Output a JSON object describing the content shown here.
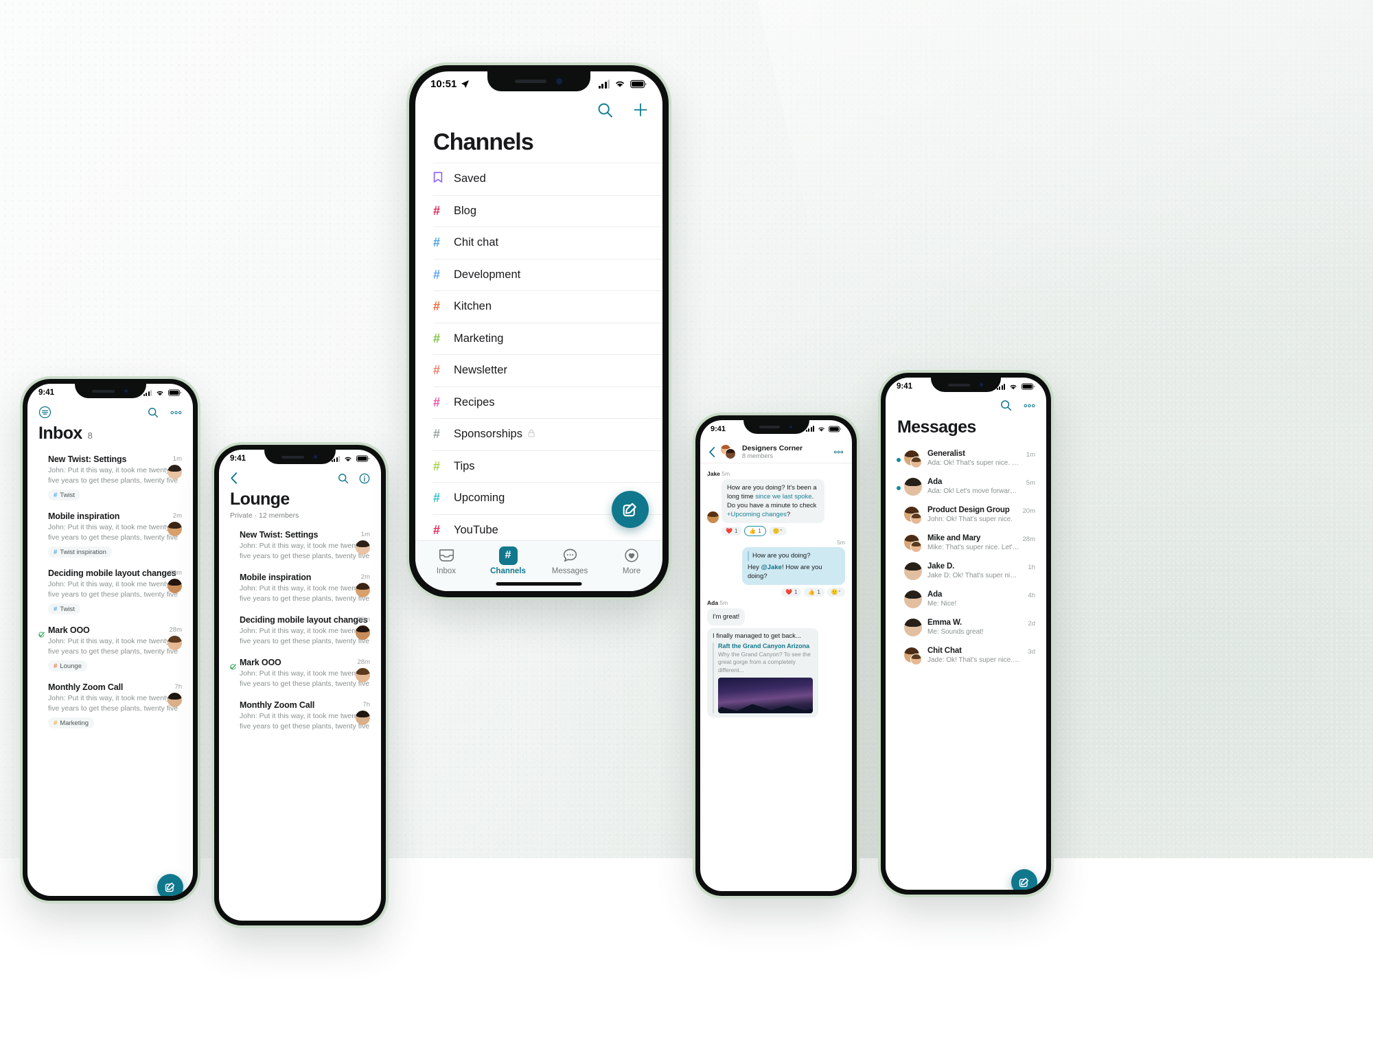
{
  "channels_phone": {
    "status": {
      "time": "10:51",
      "location_icon": "location-arrow-icon"
    },
    "nav": {
      "search": "search-icon",
      "add": "plus-icon"
    },
    "title": "Channels",
    "rows": [
      {
        "label": "Saved",
        "glyph": "bookmark-icon",
        "color": "#8b5cf6",
        "locked": false
      },
      {
        "label": "Blog",
        "glyph": "#",
        "color": "#e0295b",
        "locked": false
      },
      {
        "label": "Chit chat",
        "glyph": "#",
        "color": "#4aa3e8",
        "locked": false
      },
      {
        "label": "Development",
        "glyph": "#",
        "color": "#5fa8ef",
        "locked": false
      },
      {
        "label": "Kitchen",
        "glyph": "#",
        "color": "#ef6a3c",
        "locked": false
      },
      {
        "label": "Marketing",
        "glyph": "#",
        "color": "#7fc542",
        "locked": false
      },
      {
        "label": "Newsletter",
        "glyph": "#",
        "color": "#f07f6a",
        "locked": false
      },
      {
        "label": "Recipes",
        "glyph": "#",
        "color": "#e857a8",
        "locked": false
      },
      {
        "label": "Sponsorships",
        "glyph": "#",
        "color": "#9aa3a2",
        "locked": true
      },
      {
        "label": "Tips",
        "glyph": "#",
        "color": "#a6d44a",
        "locked": false
      },
      {
        "label": "Upcoming",
        "glyph": "#",
        "color": "#35c5cf",
        "locked": false
      },
      {
        "label": "YouTube",
        "glyph": "#",
        "color": "#e0295b",
        "locked": false
      }
    ],
    "compose": "compose-icon",
    "tabs": [
      {
        "label": "Inbox",
        "icon": "inbox-icon",
        "active": false
      },
      {
        "label": "Channels",
        "icon": "hash-icon",
        "active": true
      },
      {
        "label": "Messages",
        "icon": "chat-bubble-icon",
        "active": false
      },
      {
        "label": "More",
        "icon": "heart-circle-icon",
        "active": false
      }
    ]
  },
  "inbox_phone": {
    "status": {
      "time": "9:41"
    },
    "nav": {
      "filter": "filter-icon",
      "search": "search-icon"
    },
    "title": "Inbox",
    "count": "8",
    "items": [
      {
        "title": "New Twist: Settings",
        "preview": "John: Put it this way, it took me twenty five years to get these plants, twenty five years of",
        "channel": "Twist",
        "channel_color": "#4aa3e8",
        "time": "1m",
        "marker": "unread-dot",
        "avatar": "face-a"
      },
      {
        "title": "Mobile inspiration",
        "preview": "John: Put it this way, it took me twenty five years to get these plants, twenty five years of",
        "channel": "Twist inspiration",
        "channel_color": "#4aa3e8",
        "time": "2m",
        "marker": "purple-square",
        "avatar": "face-b"
      },
      {
        "title": "Deciding mobile layout changes",
        "preview": "John: Put it this way, it took me twenty five years to get these plants, twenty five years of",
        "channel": "Twist",
        "channel_color": "#4aa3e8",
        "time": "20m",
        "marker": "none",
        "avatar": "face-c"
      },
      {
        "title": "Mark OOO",
        "preview": "John: Put it this way, it took me twenty five years to get these plants, twenty five years of",
        "channel": "Lounge",
        "channel_color": "#ef6a3c",
        "time": "28m",
        "marker": "green-check",
        "avatar": "face-d"
      },
      {
        "title": "Monthly Zoom Call",
        "preview": "John: Put it this way, it took me twenty five years to get these plants, twenty five years of",
        "channel": "Marketing",
        "channel_color": "#f0a93c",
        "time": "7h",
        "marker": "unread-dot",
        "avatar": "face-e"
      }
    ],
    "compose": "compose-icon"
  },
  "lounge_phone": {
    "status": {
      "time": "9:41"
    },
    "nav": {
      "back": "chevron-left-icon",
      "search": "search-icon",
      "info": "info-circle-icon"
    },
    "title": "Lounge",
    "subtitle": "Private · 12 members",
    "items": [
      {
        "title": "New Twist: Settings",
        "preview": "John: Put it this way, it took me twenty five years to get these plants, twenty five years of",
        "time": "1m",
        "marker": "unread-dot",
        "avatar": "face-a"
      },
      {
        "title": "Mobile inspiration",
        "preview": "John: Put it this way, it took me twenty five years to get these plants, twenty five years of",
        "time": "2m",
        "marker": "purple-square",
        "avatar": "face-b"
      },
      {
        "title": "Deciding mobile layout changes",
        "preview": "John: Put it this way, it took me twenty five years to get these plants, twenty five years of",
        "time": "20m",
        "marker": "none",
        "avatar": "face-c"
      },
      {
        "title": "Mark OOO",
        "preview": "John: Put it this way, it took me twenty five years to get these plants, twenty five years of",
        "time": "28m",
        "marker": "green-check",
        "avatar": "face-d"
      },
      {
        "title": "Monthly Zoom Call",
        "preview": "John: Put it this way, it took me twenty five years to get these plants, twenty five years of",
        "time": "7h",
        "marker": "unread-dot",
        "avatar": "face-e"
      }
    ]
  },
  "chat_phone": {
    "status": {
      "time": "9:41"
    },
    "header": {
      "back": "chevron-left-icon",
      "name": "Designers Corner",
      "members": "8 members",
      "more": "more-horizontal-icon"
    },
    "messages": [
      {
        "author": "Jake",
        "time": "5m",
        "side": "left",
        "text_parts": [
          {
            "t": "How are you doing? It's been a long time ",
            "style": "plain"
          },
          {
            "t": "since we last spoke",
            "style": "link"
          },
          {
            "t": ". Do you have a minute to check ",
            "style": "plain"
          },
          {
            "t": "+Upcoming changes",
            "style": "link"
          },
          {
            "t": "?",
            "style": "plain"
          }
        ],
        "reactions": [
          {
            "emoji": "❤️",
            "count": "1",
            "selected": false
          },
          {
            "emoji": "👍",
            "count": "1",
            "selected": true
          }
        ],
        "add_reaction": "add-reaction-icon"
      },
      {
        "time": "5m",
        "side": "right",
        "quote": "How are you doing?",
        "text_parts": [
          {
            "t": "Hey ",
            "style": "plain"
          },
          {
            "t": "@Jake",
            "style": "mention"
          },
          {
            "t": "! How are you doing?",
            "style": "plain"
          }
        ],
        "reactions": [
          {
            "emoji": "❤️",
            "count": "1",
            "selected": false
          },
          {
            "emoji": "👍",
            "count": "1",
            "selected": false
          }
        ],
        "add_reaction": "add-reaction-icon"
      },
      {
        "author": "Ada",
        "time": "5m",
        "side": "left",
        "text_parts": [
          {
            "t": "I'm great!",
            "style": "plain"
          }
        ]
      }
    ],
    "link_card": {
      "caption": "I finally managed to get back...",
      "title": "Raft the Grand Canyon Arizona",
      "description": "Why the Grand Canyon? To see the great gorge from a completely different...",
      "image": "night-sky-mountains-photo"
    }
  },
  "messages_phone": {
    "status": {
      "time": "9:41"
    },
    "nav": {
      "search": "search-icon",
      "more": "more-horizontal-icon"
    },
    "title": "Messages",
    "items": [
      {
        "name": "Generalist",
        "preview": "Ada: Ok! That's super nice. For now let's mo...",
        "time": "1m",
        "unread": true,
        "avatar": "group"
      },
      {
        "name": "Ada",
        "preview": "Ada: Ok! Let's move forward with this.",
        "time": "5m",
        "unread": true,
        "avatar": "solo"
      },
      {
        "name": "Product Design Group",
        "preview": "John: Ok! That's super nice.",
        "time": "20m",
        "unread": false,
        "avatar": "group"
      },
      {
        "name": "Mike and Mary",
        "preview": "Mike: That's super nice. Let's move forward.",
        "time": "28m",
        "unread": false,
        "avatar": "group"
      },
      {
        "name": "Jake D.",
        "preview": "Jake D: Ok! That's super nice. For now let's",
        "time": "1h",
        "unread": false,
        "avatar": "solo"
      },
      {
        "name": "Ada",
        "preview": "Me: Nice!",
        "time": "4h",
        "unread": false,
        "avatar": "solo"
      },
      {
        "name": "Emma W.",
        "preview": "Me: Sounds great!",
        "time": "2d",
        "unread": false,
        "avatar": "solo"
      },
      {
        "name": "Chit Chat",
        "preview": "Jade: Ok! That's super nice. For now l...",
        "time": "3d",
        "unread": false,
        "avatar": "group"
      }
    ],
    "compose": "compose-icon"
  },
  "theme": {
    "accent": "#10778c",
    "accent_light": "#0f8ba0",
    "text": "#17191a",
    "muted": "#8a9190",
    "bubble_grey": "#f0f3f4",
    "bubble_blue": "#cfe9f3",
    "device_frame": "#0d0f0e",
    "device_edge": "#cbdcc9"
  }
}
